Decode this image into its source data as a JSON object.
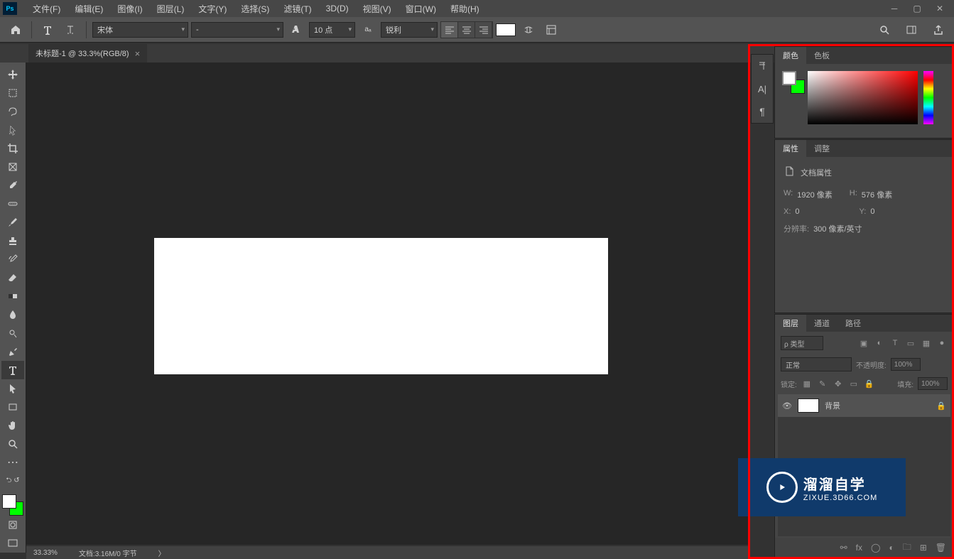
{
  "app": {
    "logo": "Ps"
  },
  "menu": {
    "file": "文件(F)",
    "edit": "编辑(E)",
    "image": "图像(I)",
    "layer": "图层(L)",
    "type": "文字(Y)",
    "select": "选择(S)",
    "filter": "滤镜(T)",
    "threeD": "3D(D)",
    "view": "视图(V)",
    "window": "窗口(W)",
    "help": "帮助(H)"
  },
  "options": {
    "font_family": "宋体",
    "font_style": "-",
    "font_size": "10 点",
    "antialias": "锐利"
  },
  "document": {
    "tab_title": "未标题-1 @ 33.3%(RGB/8)"
  },
  "panels": {
    "color": {
      "tab1": "颜色",
      "tab2": "色板"
    },
    "properties": {
      "tab1": "属性",
      "tab2": "调整",
      "title": "文档属性",
      "w_label": "W:",
      "w_value": "1920 像素",
      "h_label": "H:",
      "h_value": "576 像素",
      "x_label": "X:",
      "x_value": "0",
      "y_label": "Y:",
      "y_value": "0",
      "res_label": "分辨率:",
      "res_value": "300 像素/英寸"
    },
    "layers": {
      "tab1": "图层",
      "tab2": "通道",
      "tab3": "路径",
      "filter_kind": "ρ 类型",
      "blend_mode": "正常",
      "opacity_label": "不透明度:",
      "opacity_value": "100%",
      "lock_label": "锁定:",
      "fill_label": "填充:",
      "fill_value": "100%",
      "layer_name": "背景"
    }
  },
  "statusbar": {
    "zoom": "33.33%",
    "docinfo": "文档:3.16M/0 字节"
  },
  "watermark": {
    "title": "溜溜自学",
    "url": "ZIXUE.3D66.COM"
  }
}
